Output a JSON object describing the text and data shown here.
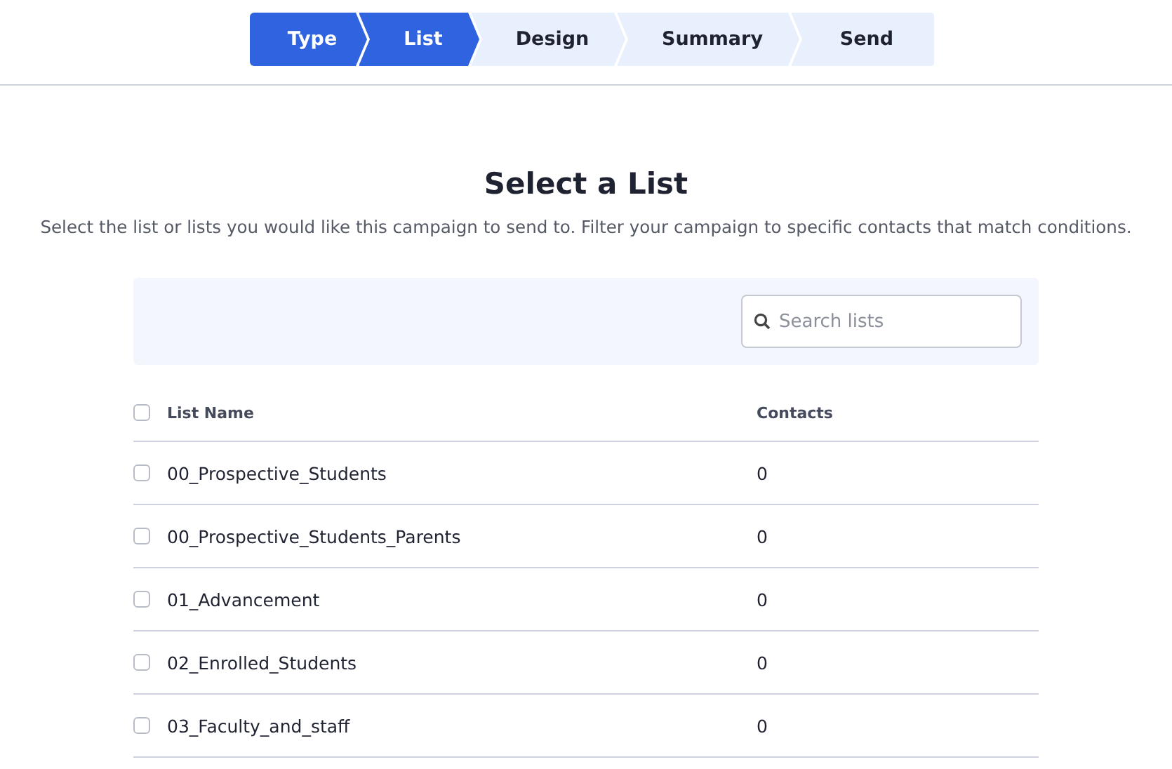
{
  "steps": [
    {
      "label": "Type",
      "active": true
    },
    {
      "label": "List",
      "active": true
    },
    {
      "label": "Design",
      "active": false
    },
    {
      "label": "Summary",
      "active": false
    },
    {
      "label": "Send",
      "active": false
    }
  ],
  "title": "Select a List",
  "subtitle": "Select the list or lists you would like this campaign to send to. Filter your campaign to specific contacts that match conditions.",
  "search": {
    "placeholder": "Search lists"
  },
  "table": {
    "columns": [
      "List Name",
      "Contacts"
    ],
    "all_checked": false,
    "rows": [
      {
        "name": "00_Prospective_Students",
        "contacts": "0",
        "checked": false
      },
      {
        "name": "00_Prospective_Students_Parents",
        "contacts": "0",
        "checked": false
      },
      {
        "name": "01_Advancement",
        "contacts": "0",
        "checked": false
      },
      {
        "name": "02_Enrolled_Students",
        "contacts": "0",
        "checked": false
      },
      {
        "name": "03_Faculty_and_staff",
        "contacts": "0",
        "checked": false
      }
    ]
  }
}
